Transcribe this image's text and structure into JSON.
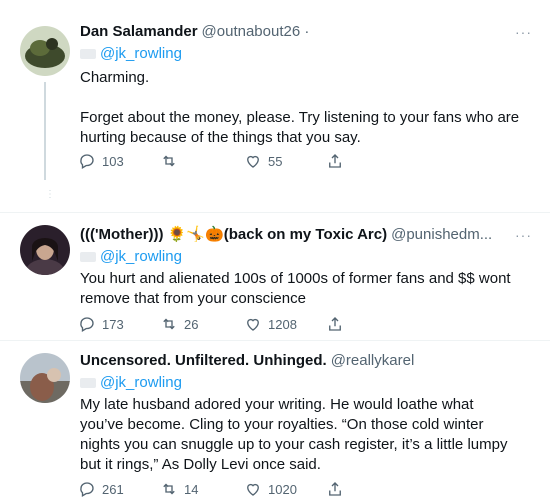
{
  "tweets": [
    {
      "name": "Dan Salamander",
      "handle": "@outnabout26 ·",
      "reply_to": "@jk_rowling",
      "body": [
        "Charming.",
        "Forget about the money, please. Try listening to your fans who are hurting because of the things that you say."
      ],
      "replies": "103",
      "retweets": "",
      "likes": "55",
      "more": "···"
    },
    {
      "name": "((('Mother))) 🌻🤸🎃(back on my Toxic Arc)",
      "handle": "@punishedm...",
      "reply_to": "@jk_rowling",
      "body": [
        "You hurt and alienated 100s of 1000s of former fans and $$ wont remove that from your conscience"
      ],
      "replies": "173",
      "retweets": "26",
      "likes": "1208",
      "more": "···"
    },
    {
      "name": "Uncensored. Unfiltered. Unhinged.",
      "handle": "@reallykarel",
      "reply_to": "@jk_rowling",
      "body": [
        "My late husband adored your writing. He would loathe what you’ve become. Cling to your royalties. “On those cold winter nights you can snuggle up to your cash register, it’s a little lumpy but it rings,” As Dolly Levi once said."
      ],
      "replies": "261",
      "retweets": "14",
      "likes": "1020",
      "more": "···"
    }
  ],
  "colors": {
    "accent": "#1d9bf0",
    "secondary_text": "#536471",
    "divider": "#eff3f4"
  },
  "icons": [
    "reply-icon",
    "retweet-icon",
    "like-icon",
    "share-icon",
    "more-icon"
  ]
}
